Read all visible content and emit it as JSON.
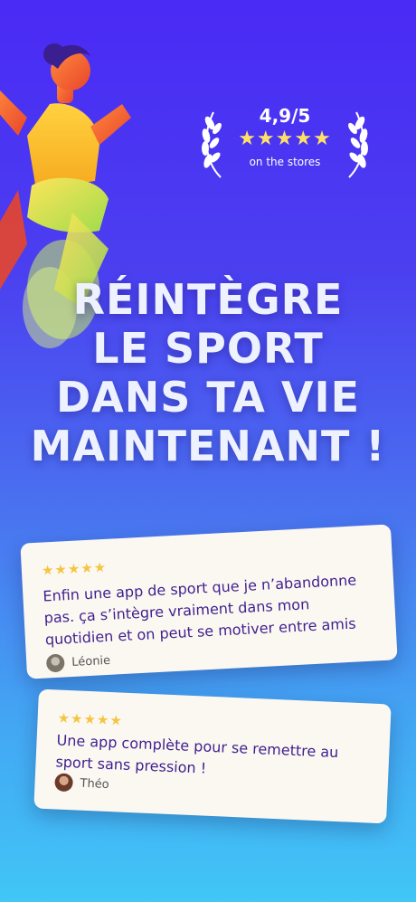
{
  "rating": {
    "score": "4,9/5",
    "stars": "★★★★★",
    "subtitle": "on the stores"
  },
  "headline": {
    "line1": "RÉINTÈGRE",
    "line2": "LE SPORT",
    "line3": "DANS TA VIE",
    "line4": "MAINTENANT !"
  },
  "reviews": [
    {
      "stars": "★★★★★",
      "text": "Enfin une app de sport que je n’abandonne pas. ça s’intègre vraiment dans mon quotidien et on peut se motiver entre amis",
      "author": "Léonie"
    },
    {
      "stars": "★★★★★",
      "text": "Une app complète pour se remettre au sport sans pression !",
      "author": "Théo"
    }
  ],
  "colors": {
    "gradient_top": "#4a2af5",
    "gradient_bottom": "#41c6f6",
    "review_text": "#3f1f8e",
    "star": "#f5c542"
  }
}
